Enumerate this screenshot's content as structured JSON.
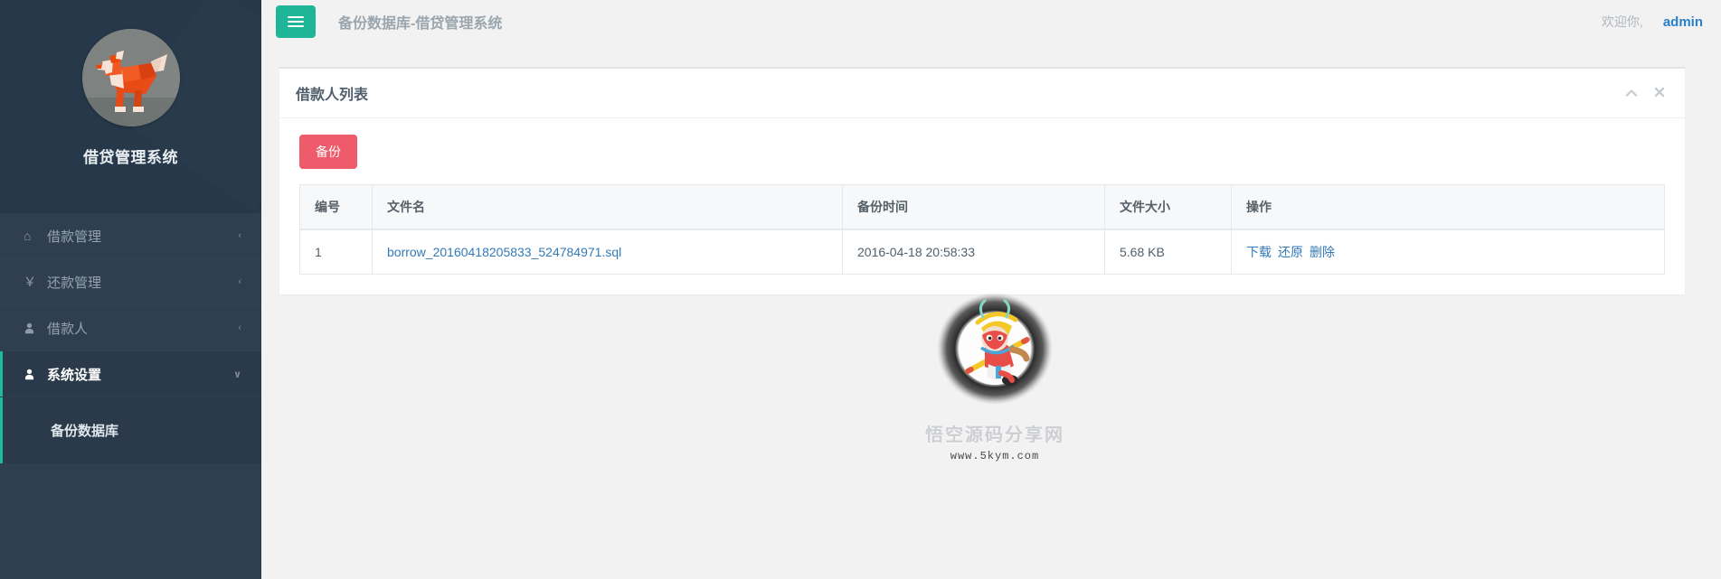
{
  "sidebar": {
    "brand_title": "借贷管理系统",
    "avatar_icon": "origami-dog-avatar",
    "items": [
      {
        "label": "借款管理",
        "icon": "home-icon",
        "icon_glyph": "⌂",
        "arrow": "‹",
        "active": false
      },
      {
        "label": "还款管理",
        "icon": "yen-icon",
        "icon_glyph": "￥",
        "arrow": "‹",
        "active": false
      },
      {
        "label": "借款人",
        "icon": "user-icon",
        "icon_glyph": "♟",
        "arrow": "‹",
        "active": false
      },
      {
        "label": "系统设置",
        "icon": "user-icon",
        "icon_glyph": "♟",
        "arrow": "∨",
        "active": true
      }
    ],
    "submenu": [
      {
        "label": "备份数据库"
      }
    ]
  },
  "topbar": {
    "menu_toggle_icon": "hamburger-icon",
    "page_title": "备份数据库-借贷管理系统",
    "welcome_text": "欢迎你,",
    "user_name": "admin"
  },
  "panel": {
    "title": "借款人列表",
    "collapse_icon": "chevron-up-icon",
    "close_icon": "close-icon",
    "backup_button": "备份"
  },
  "table": {
    "headers": [
      "编号",
      "文件名",
      "备份时间",
      "文件大小",
      "操作"
    ],
    "rows": [
      {
        "id": "1",
        "filename": "borrow_20160418205833_524784971.sql",
        "time": "2016-04-18 20:58:33",
        "size": "5.68 KB",
        "actions": [
          "下载",
          "还原",
          "删除"
        ]
      }
    ]
  },
  "watermark": {
    "logo_icon": "monkey-king-logo",
    "text": "悟空源码分享网",
    "url": "www.5kym.com"
  },
  "colors": {
    "sidebar_dark": "#263849",
    "sidebar_base": "#303f4f",
    "accent_green": "#1abc9c",
    "button_red": "#ef5b6b",
    "link_blue": "#337ab7",
    "user_blue": "#2a7fc9"
  }
}
